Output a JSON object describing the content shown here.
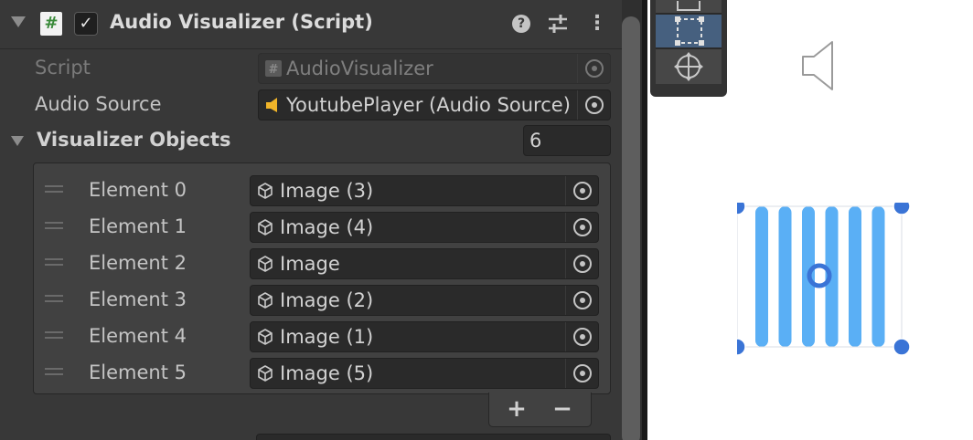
{
  "component": {
    "title": "Audio Visualizer (Script)",
    "enabled": true,
    "icons": [
      "script-icon",
      "help-icon",
      "presets-icon",
      "more-icon"
    ]
  },
  "script_field": {
    "label": "Script",
    "value": "AudioVisualizer"
  },
  "audio_source_field": {
    "label": "Audio Source",
    "value": "YoutubePlayer (Audio Source)"
  },
  "visualizer_objects": {
    "label": "Visualizer Objects",
    "size": "6",
    "elements": [
      {
        "label": "Element 0",
        "value": "Image (3)"
      },
      {
        "label": "Element 1",
        "value": "Image (4)"
      },
      {
        "label": "Element 2",
        "value": "Image"
      },
      {
        "label": "Element 3",
        "value": "Image (2)"
      },
      {
        "label": "Element 4",
        "value": "Image (1)"
      },
      {
        "label": "Element 5",
        "value": "Image (5)"
      }
    ],
    "add_label": "+",
    "remove_label": "−"
  },
  "scene": {
    "bar_color": "#5aaff5",
    "handle_color": "#3a74d6",
    "bar_count": 6
  }
}
